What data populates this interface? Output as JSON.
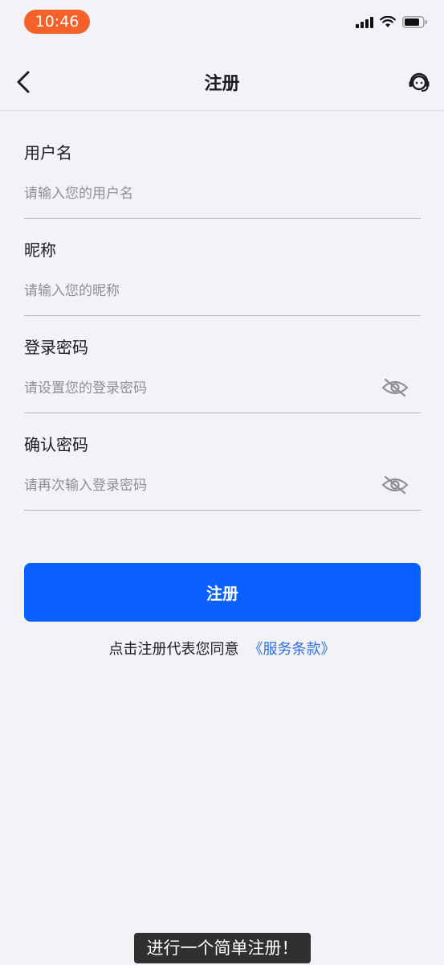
{
  "status_bar": {
    "time": "10:46"
  },
  "nav": {
    "title": "注册"
  },
  "form": {
    "username": {
      "label": "用户名",
      "placeholder": "请输入您的用户名"
    },
    "nickname": {
      "label": "昵称",
      "placeholder": "请输入您的昵称"
    },
    "password": {
      "label": "登录密码",
      "placeholder": "请设置您的登录密码"
    },
    "confirm_password": {
      "label": "确认密码",
      "placeholder": "请再次输入登录密码"
    }
  },
  "submit": {
    "label": "注册"
  },
  "terms": {
    "prefix": "点击注册代表您同意",
    "link": "《服务条款》"
  },
  "caption": {
    "text": "进行一个简单注册！"
  },
  "colors": {
    "primary": "#0a60ff",
    "link": "#2f6fe0",
    "time_pill": "#f4622a",
    "background": "#f2f2f7"
  }
}
